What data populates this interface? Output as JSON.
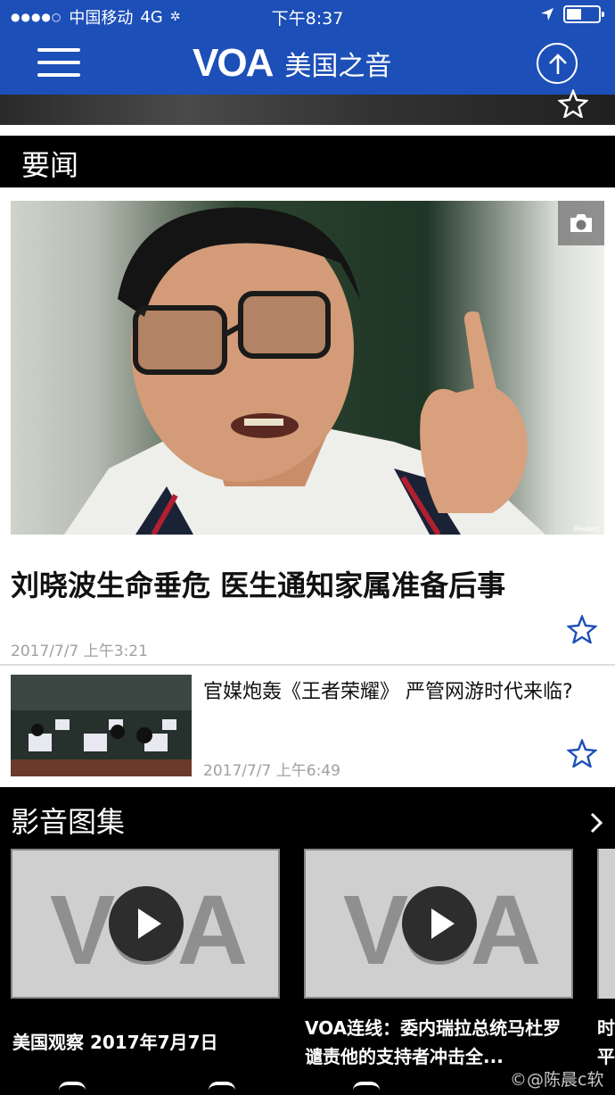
{
  "status_bar": {
    "carrier": "中国移动",
    "network": "4G",
    "time": "下午8:37"
  },
  "header": {
    "logo_text": "VOA",
    "brand_name": "美国之音"
  },
  "section": {
    "title": "要闻"
  },
  "top_story": {
    "credit": "Reuters",
    "headline": "刘晓波生命垂危 医生通知家属准备后事",
    "date": "2017/7/7 上午3:21"
  },
  "second_story": {
    "title": "官媒炮轰《王者荣耀》 严管网游时代来临?",
    "date": "2017/7/7 上午6:49"
  },
  "gallery": {
    "title": "影音图集",
    "items": [
      {
        "title": "美国观察 2017年7月7日"
      },
      {
        "title": "VOA连线：委内瑞拉总统马杜罗谴责他的支持者冲击全..."
      },
      {
        "title": "时 平"
      }
    ]
  },
  "watermark": "©@陈晨c软",
  "colors": {
    "brand_blue": "#1d4fb8",
    "star_blue": "#1d4fb8",
    "date_gray": "#a0a0a0"
  }
}
